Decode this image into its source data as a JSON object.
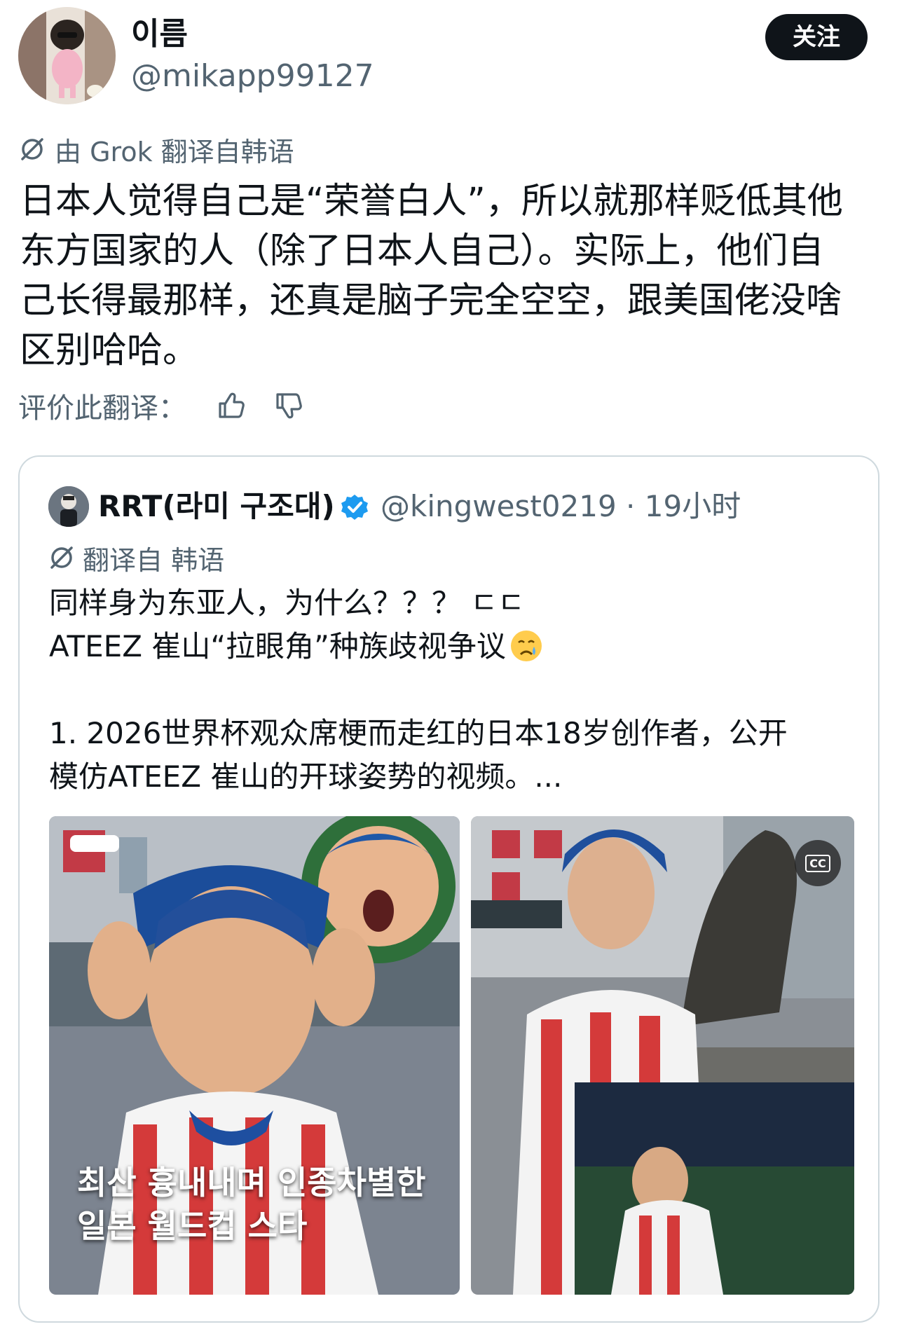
{
  "user": {
    "display_name": "이름",
    "handle": "@mikapp99127",
    "follow_label": "关注"
  },
  "translation_note": "由 Grok 翻译自韩语",
  "tweet_lines": [
    "日本人觉得自己是“荣誉白人”，所以就那样贬低其他",
    "东方国家的人（除了日本人自己）。实际上，他们自",
    "己长得最那样，还真是脑子完全空空，跟美国佬没啥",
    "区别哈哈。"
  ],
  "rate_translation_label": "评价此翻译：",
  "quote": {
    "display_name": "RRT(라미 구조대)",
    "handle_time": "@kingwest0219 · 19小时",
    "translated_note": "翻译自 韩语",
    "lines": [
      "同样身为东亚人，为什么？？？ ㄷㄷ",
      "ATEEZ 崔山“拉眼角”种族歧视争议",
      "",
      "1. 2026世界杯观众席梗而走红的日本18岁创作者，公开",
      "模仿ATEEZ 崔山的开球姿势的视频。..."
    ],
    "media_left_caption": [
      "최산 흉내내며 인종차별한",
      "일본 월드컵 스타"
    ],
    "media_right_badge": "CC"
  },
  "icons": {
    "grok": "grok-slash-icon",
    "thumbs_up": "thumbs-up-icon",
    "thumbs_down": "thumbs-down-icon",
    "verified": "verified-badge-icon",
    "crying": "crying-face-emoji"
  },
  "colors": {
    "text": "#0f1419",
    "secondary": "#536471",
    "verified_blue": "#1d9bf0",
    "border": "#cfd9de"
  }
}
